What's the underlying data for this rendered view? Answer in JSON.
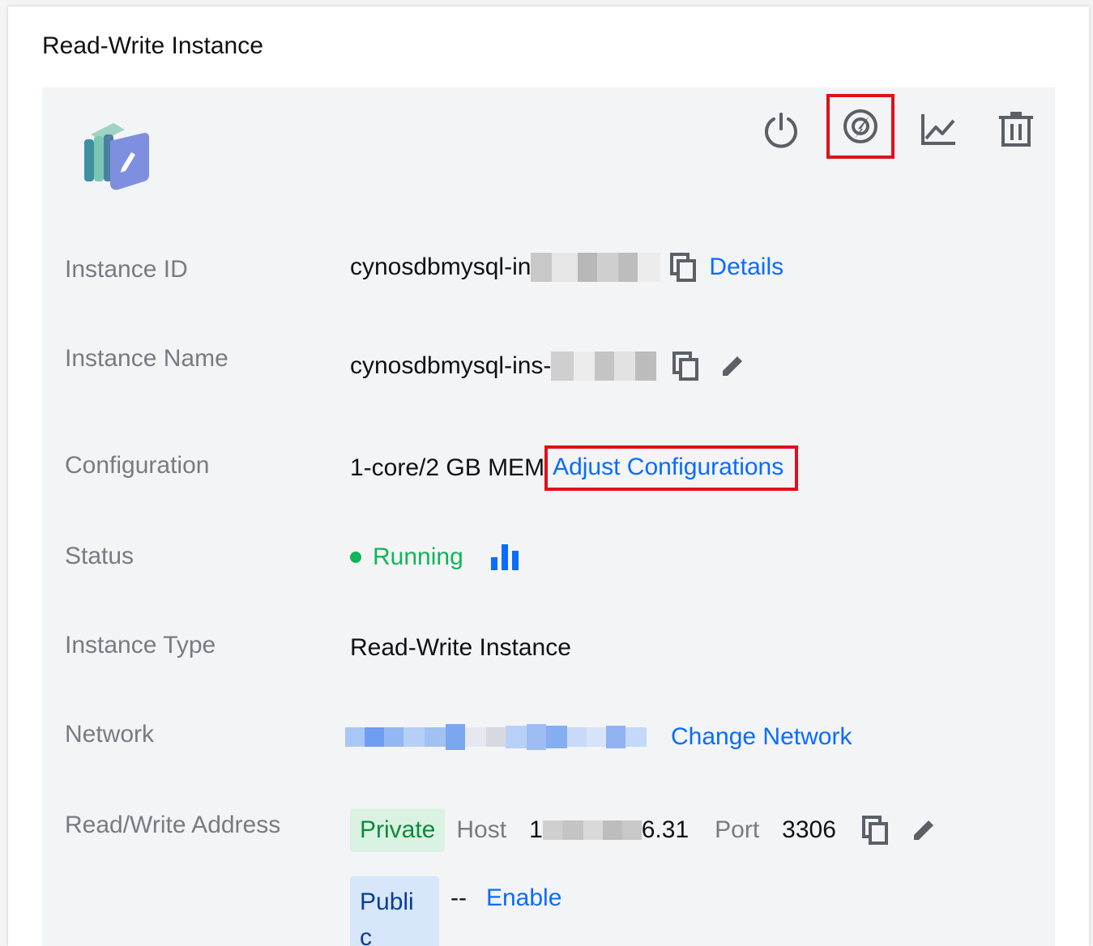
{
  "panel": {
    "title": "Read-Write Instance"
  },
  "toolbar": {
    "power": "power-icon",
    "upgrade": "speed-upgrade-icon",
    "monitor": "line-chart-icon",
    "delete": "trash-icon"
  },
  "rows": {
    "instance_id": {
      "label": "Instance ID",
      "value": "cynosdbmysql-in",
      "link": "Details"
    },
    "instance_name": {
      "label": "Instance Name",
      "value": "cynosdbmysql-ins-"
    },
    "configuration": {
      "label": "Configuration",
      "value": "1-core/2 GB MEM",
      "link": "Adjust Configurations"
    },
    "status": {
      "label": "Status",
      "value": "Running"
    },
    "instance_type": {
      "label": "Instance Type",
      "value": "Read-Write Instance"
    },
    "network": {
      "label": "Network",
      "link": "Change Network"
    },
    "address": {
      "label": "Read/Write Address",
      "private_tag": "Private",
      "host_label": "Host",
      "host_prefix": "1",
      "host_suffix": "6.31",
      "port_label": "Port",
      "port_value": "3306",
      "public_tag": "Publi c",
      "public_value": "--",
      "enable_link": "Enable"
    }
  },
  "colors": {
    "accent": "#0a6cff",
    "highlight": "#e0101a",
    "running": "#11b55a"
  }
}
